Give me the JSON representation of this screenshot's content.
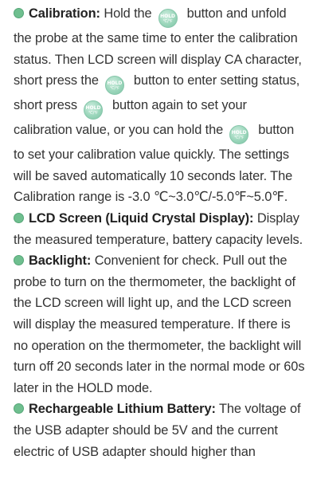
{
  "icons": {
    "bullet": "green-circle-icon",
    "hold_button": "hold-button-icon",
    "hold_top": "HOLD",
    "hold_bottom": "℃/℉"
  },
  "colors": {
    "bullet": "#6fbf8f",
    "hold_button": "#9bd6bb",
    "text": "#333333"
  },
  "calibration": {
    "label": "Calibration:",
    "t1": " Hold the",
    "t2": "button and unfold the probe at the same time to enter the calibration status. Then LCD screen will display CA character, short press the",
    "t3": "button to enter setting status, short press",
    "t4": "button again to set your calibration value, or you can hold the",
    "t5": "button to set your calibration value quickly. The settings will be saved automatically 10 seconds later. The Calibration range is -3.0 ℃~3.0℃/-5.0℉~5.0℉."
  },
  "lcd": {
    "label": "LCD Screen (Liquid Crystal Display):",
    "text": " Display the measured temperature, battery capacity levels."
  },
  "backlight": {
    "label": "Backlight:",
    "text": " Convenient for check. Pull out the probe to turn on the thermometer, the backlight of the LCD screen will light up, and the LCD screen will display the measured temperature. If there is no operation on the thermometer, the backlight will turn off 20 seconds later in the normal mode or 60s later in the HOLD mode."
  },
  "battery": {
    "label": "Rechargeable Lithium Battery:",
    "text": " The voltage of the USB adapter should be 5V and the current electric of USB adapter should higher than"
  }
}
